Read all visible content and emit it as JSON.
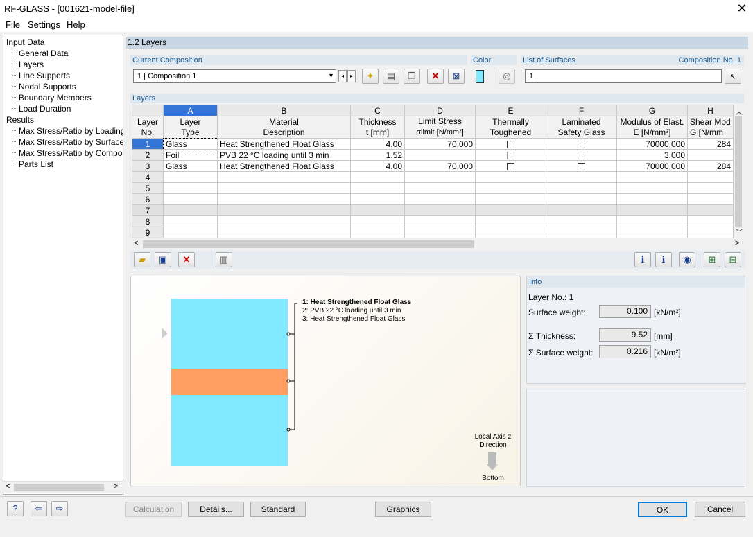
{
  "window": {
    "title": "RF-GLASS - [001621-model-file]"
  },
  "menu": [
    "File",
    "Settings",
    "Help"
  ],
  "tree": {
    "input_root": "Input Data",
    "input_items": [
      "General Data",
      "Layers",
      "Line Supports",
      "Nodal Supports",
      "Boundary Members",
      "Load Duration"
    ],
    "results_root": "Results",
    "results_items": [
      "Max Stress/Ratio by Loading",
      "Max Stress/Ratio by Surface",
      "Max Stress/Ratio by Composition",
      "Parts List"
    ]
  },
  "section_title": "1.2 Layers",
  "composition": {
    "label": "Current Composition",
    "value": "1 | Composition 1"
  },
  "color": {
    "label": "Color",
    "swatch": "#80e8ff"
  },
  "surfaces": {
    "label": "List of Surfaces",
    "comp_no": "Composition No. 1",
    "value": "1"
  },
  "layers": {
    "label": "Layers",
    "col_letters": [
      "A",
      "B",
      "C",
      "D",
      "E",
      "F",
      "G",
      "H"
    ],
    "header_row1": [
      "Layer",
      "Material",
      "Thickness",
      "Limit Stress",
      "Thermally",
      "Laminated",
      "Modulus of Elast.",
      "Shear Mod"
    ],
    "header_row2": [
      "Type",
      "Description",
      "t [mm]",
      "σlimit [N/mm²]",
      "Toughened",
      "Safety Glass",
      "E [N/mm²]",
      "G [N/mm"
    ],
    "layer_no_l1": "Layer",
    "layer_no_l2": "No.",
    "rows": [
      {
        "no": "1",
        "type": "Glass",
        "desc": "Heat Strengthened Float Glass",
        "t": "4.00",
        "limit": "70.000",
        "E": "70000.000",
        "G": "284"
      },
      {
        "no": "2",
        "type": "Foil",
        "desc": "PVB 22 °C loading until 3 min",
        "t": "1.52",
        "limit": "",
        "E": "3.000",
        "G": ""
      },
      {
        "no": "3",
        "type": "Glass",
        "desc": "Heat Strengthened Float Glass",
        "t": "4.00",
        "limit": "70.000",
        "E": "70000.000",
        "G": "284"
      },
      {
        "no": "4"
      },
      {
        "no": "5"
      },
      {
        "no": "6"
      },
      {
        "no": "7"
      },
      {
        "no": "8"
      },
      {
        "no": "9"
      }
    ]
  },
  "graphic": {
    "legend": [
      "1: Heat Strengthened Float Glass",
      "2: PVB 22 °C loading until 3 min",
      "3: Heat Strengthened Float Glass"
    ],
    "axis_l1": "Local Axis z",
    "axis_l2": "Direction",
    "axis_bottom": "Bottom",
    "glass_color": "#80e8ff",
    "foil_color": "#ff9e60"
  },
  "info": {
    "title": "Info",
    "layer_no": "Layer No.: 1",
    "surface_weight_label": "Surface weight:",
    "surface_weight": "0.100",
    "surface_weight_unit": "[kN/m²]",
    "sum_thickness_label": "Σ Thickness:",
    "sum_thickness": "9.52",
    "sum_thickness_unit": "[mm]",
    "sum_weight_label": "Σ Surface weight:",
    "sum_weight": "0.216",
    "sum_weight_unit": "[kN/m²]"
  },
  "buttons": {
    "calculation": "Calculation",
    "details": "Details...",
    "standard": "Standard",
    "graphics": "Graphics",
    "ok": "OK",
    "cancel": "Cancel"
  }
}
